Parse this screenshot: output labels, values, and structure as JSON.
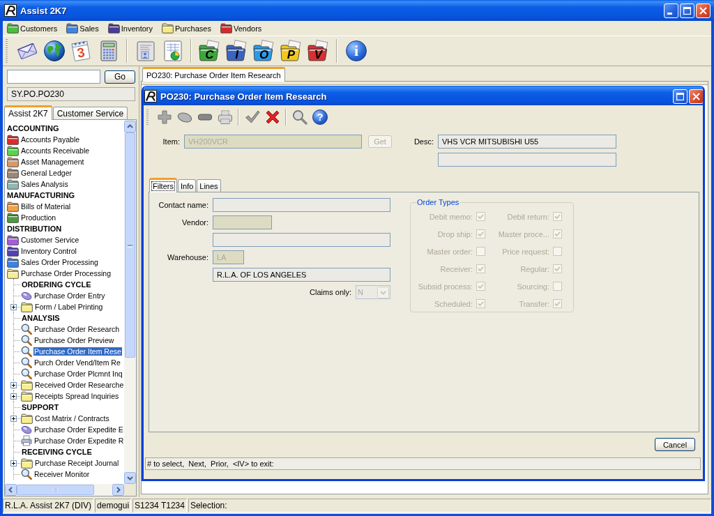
{
  "window": {
    "title": "Assist 2K7"
  },
  "menu": [
    {
      "label": "Customers",
      "color": "#46c23c"
    },
    {
      "label": "Sales",
      "color": "#3f86e2"
    },
    {
      "label": "Inventory",
      "color": "#4a3a9e"
    },
    {
      "label": "Purchases",
      "color": "#f6ea86"
    },
    {
      "label": "Vendors",
      "color": "#d92a2a"
    }
  ],
  "toolbar": [
    [
      {
        "kind": "envelope"
      },
      {
        "kind": "globe"
      },
      {
        "kind": "calendar",
        "text": "3"
      },
      {
        "kind": "calculator"
      }
    ],
    [
      {
        "kind": "address-card"
      },
      {
        "kind": "chart-sheet"
      }
    ],
    [
      {
        "kind": "letter-folder",
        "text": "C",
        "color": "#3ca83c"
      },
      {
        "kind": "letter-folder",
        "text": "I",
        "color": "#3a64c0"
      },
      {
        "kind": "letter-folder",
        "text": "O",
        "color": "#2a9ae8"
      },
      {
        "kind": "letter-folder",
        "text": "P",
        "color": "#f2c81e"
      },
      {
        "kind": "letter-folder",
        "text": "V",
        "color": "#d83030"
      }
    ],
    [
      {
        "kind": "info",
        "text": "i"
      }
    ]
  ],
  "sidebar": {
    "go_button": "Go",
    "path": "SY.PO.PO230",
    "tabs": [
      {
        "label": "Assist 2K7",
        "selected": true
      },
      {
        "label": "Customer Service",
        "selected": false
      }
    ],
    "tree": [
      {
        "kind": "heading",
        "label": "ACCOUNTING",
        "selected": false
      },
      {
        "kind": "folder",
        "label": "Accounts Payable",
        "color": "#e02a2a",
        "selected": false
      },
      {
        "kind": "folder",
        "label": "Accounts Receivable",
        "color": "#5cd24c",
        "selected": false
      },
      {
        "kind": "folder",
        "label": "Asset Management",
        "color": "#d99a66",
        "selected": false
      },
      {
        "kind": "folder",
        "label": "General Ledger",
        "color": "#9c8878",
        "selected": false
      },
      {
        "kind": "folder",
        "label": "Sales Analysis",
        "color": "#8fb8b2",
        "selected": false
      },
      {
        "kind": "heading",
        "label": "MANUFACTURING",
        "selected": false
      },
      {
        "kind": "folder",
        "label": "Bills of Material",
        "color": "#f2a244",
        "selected": false
      },
      {
        "kind": "folder",
        "label": "Production",
        "color": "#4e9c3c",
        "selected": false
      },
      {
        "kind": "heading",
        "label": "DISTRIBUTION",
        "selected": false
      },
      {
        "kind": "folder",
        "label": "Customer Service",
        "color": "#a65cdb",
        "selected": false
      },
      {
        "kind": "folder",
        "label": "Inventory Control",
        "color": "#5242b4",
        "selected": false
      },
      {
        "kind": "folder",
        "label": "Sales Order Processing",
        "color": "#3c82e2",
        "selected": false
      },
      {
        "kind": "folder",
        "label": "Purchase Order Processing",
        "color": "#f8ee8c",
        "selected": false,
        "children": [
          {
            "kind": "heading",
            "label": "ORDERING CYCLE",
            "selected": false
          },
          {
            "kind": "pill",
            "label": "Purchase Order Entry",
            "selected": false
          },
          {
            "kind": "folder",
            "label": "Form / Label Printing",
            "color": "#f8ee8c",
            "selected": false,
            "expanded": false
          },
          {
            "kind": "heading",
            "label": "ANALYSIS",
            "selected": false
          },
          {
            "kind": "magnifier",
            "label": "Purchase Order Research",
            "selected": false
          },
          {
            "kind": "magnifier",
            "label": "Purchase Order Preview",
            "selected": false
          },
          {
            "kind": "magnifier",
            "label": "Purchase Order Item Rese",
            "selected": true
          },
          {
            "kind": "magnifier",
            "label": "Purch Order Vend/Item Re",
            "selected": false
          },
          {
            "kind": "magnifier",
            "label": "Purchase Order Plcmnt Inq",
            "selected": false
          },
          {
            "kind": "folder",
            "label": "Received Order Researche",
            "color": "#f8ee8c",
            "selected": false,
            "expanded": false
          },
          {
            "kind": "folder",
            "label": "Receipts Spread Inquiries",
            "color": "#f8ee8c",
            "selected": false,
            "expanded": false
          },
          {
            "kind": "heading",
            "label": "SUPPORT",
            "selected": false
          },
          {
            "kind": "folder",
            "label": "Cost Matrix / Contracts",
            "color": "#f8ee8c",
            "selected": false,
            "expanded": false
          },
          {
            "kind": "pill",
            "label": "Purchase Order Expedite E",
            "selected": false
          },
          {
            "kind": "printer",
            "label": "Purchase Order Expedite R",
            "selected": false
          },
          {
            "kind": "heading",
            "label": "RECEIVING CYCLE",
            "selected": false
          },
          {
            "kind": "folder",
            "label": "Purchase Receipt Journal",
            "color": "#f8ee8c",
            "selected": false,
            "expanded": false
          },
          {
            "kind": "magnifier",
            "label": "Receiver Monitor",
            "selected": false
          }
        ]
      }
    ]
  },
  "document_tabs": [
    {
      "label": "PO230: Purchase Order Item Research",
      "selected": true
    }
  ],
  "dialog": {
    "title": "PO230: Purchase Order Item Research",
    "toolbar": [
      [
        {
          "kind": "add",
          "disabled": true
        },
        {
          "kind": "pill",
          "disabled": true
        },
        {
          "kind": "remove",
          "disabled": true
        },
        {
          "kind": "print",
          "disabled": true
        }
      ],
      [
        {
          "kind": "accept",
          "disabled": true
        },
        {
          "kind": "cancel",
          "disabled": false
        }
      ],
      [
        {
          "kind": "search",
          "disabled": true
        },
        {
          "kind": "help",
          "text": "?",
          "disabled": false
        }
      ]
    ],
    "item": {
      "label": "Item:",
      "value": "VH200VCR",
      "disabled": true
    },
    "get_button": {
      "label": "Get",
      "disabled": true
    },
    "desc": {
      "label": "Desc:",
      "value": "VHS VCR MITSUBISHI U55"
    },
    "tabs": [
      {
        "label": "Filters",
        "selected": true
      },
      {
        "label": "Info",
        "selected": false
      },
      {
        "label": "Lines",
        "selected": false
      }
    ],
    "fields": [
      {
        "label": "Contact name:",
        "kind": "wide",
        "disabled": false
      },
      {
        "label": "Vendor:",
        "kind": "medium",
        "disabled": true
      },
      {
        "kind": "wide",
        "disabled": false
      },
      {
        "label": "Warehouse:",
        "kind": "narrow",
        "value": "LA",
        "disabled": true
      },
      {
        "kind": "wide",
        "value": "R.L.A. OF LOS ANGELES",
        "disabled": false
      }
    ],
    "claims_only": {
      "label": "Claims only:",
      "value": "N",
      "disabled": true
    },
    "order_types": {
      "title": "Order Types",
      "disabled": true,
      "items": [
        {
          "label": "Debit memo:",
          "checked": true
        },
        {
          "label": "Debit return:",
          "checked": true
        },
        {
          "label": "Drop ship:",
          "checked": true
        },
        {
          "label": "Master proce...",
          "checked": true
        },
        {
          "label": "Master order:",
          "checked": false
        },
        {
          "label": "Price request:",
          "checked": false
        },
        {
          "label": "Receiver:",
          "checked": true
        },
        {
          "label": "Regular:",
          "checked": true
        },
        {
          "label": "Subsid process:",
          "checked": true
        },
        {
          "label": "Sourcing:",
          "checked": false
        },
        {
          "label": "Scheduled:",
          "checked": true
        },
        {
          "label": "Transfer:",
          "checked": true
        }
      ]
    },
    "cancel_button": "Cancel",
    "prompt": "# to select,  Next,  Prior,  <IV> to exit:"
  },
  "status_bar": [
    "R.L.A. Assist 2K7 (DIV)",
    "demogui",
    "S1234 T1234",
    "Selection:"
  ]
}
